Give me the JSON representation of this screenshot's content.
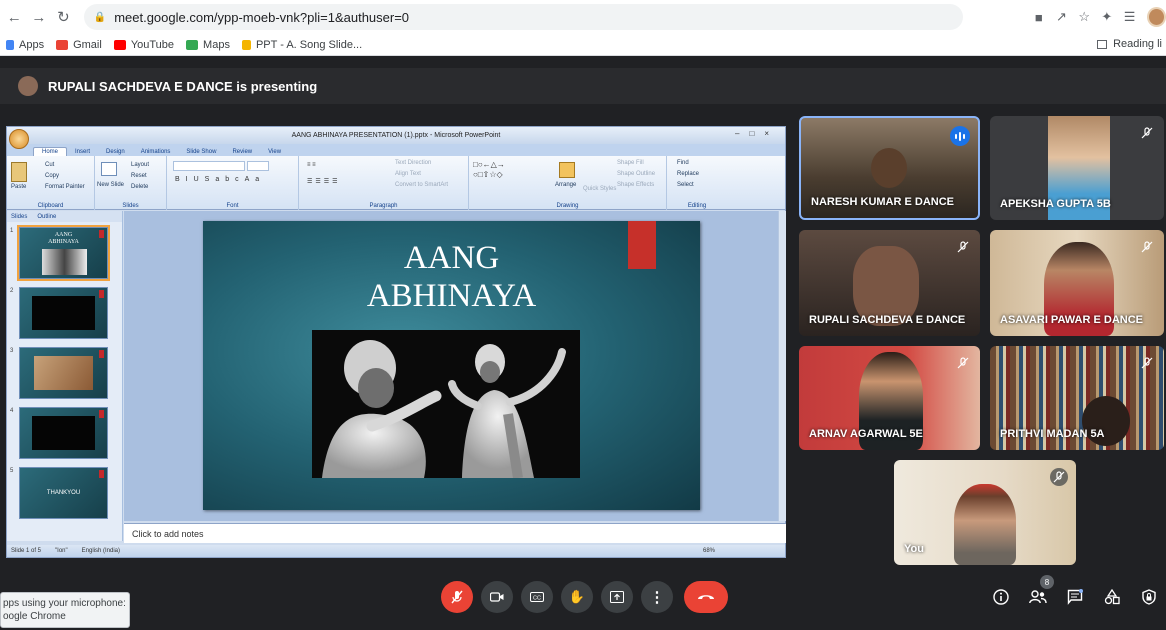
{
  "browser": {
    "url": "meet.google.com/ypp-moeb-vnk?pli=1&authuser=0",
    "bookmarks": [
      {
        "label": "Apps",
        "icon": "apps-grid-icon",
        "color": "#4285f4"
      },
      {
        "label": "Gmail",
        "icon": "gmail-icon",
        "color": "#ea4335"
      },
      {
        "label": "YouTube",
        "icon": "youtube-icon",
        "color": "#ff0000"
      },
      {
        "label": "Maps",
        "icon": "maps-icon",
        "color": "#34a853"
      },
      {
        "label": "PPT - A. Song Slide...",
        "icon": "slides-icon",
        "color": "#f4b400"
      }
    ],
    "reading_list": "Reading li"
  },
  "meet": {
    "presenting_text": "RUPALI SACHDEVA E DANCE is presenting",
    "participant_count": "8",
    "participants": [
      {
        "name": "NARESH KUMAR E DANCE",
        "mic": "speaking"
      },
      {
        "name": "APEKSHA GUPTA 5B",
        "mic": "muted"
      },
      {
        "name": "RUPALI SACHDEVA E DANCE",
        "mic": "muted"
      },
      {
        "name": "ASAVARI PAWAR E DANCE",
        "mic": "muted"
      },
      {
        "name": "ARNAV AGARWAL 5E",
        "mic": "muted"
      },
      {
        "name": "PRITHVI MADAN 5A",
        "mic": "muted"
      },
      {
        "name": "You",
        "mic": "muted"
      }
    ],
    "mic_toast": {
      "line1": "pps using your microphone:",
      "line2": "oogle Chrome"
    }
  },
  "ppt": {
    "window_title": "AANG ABHINAYA PRESENTATION (1).pptx - Microsoft PowerPoint",
    "tabs": [
      "Home",
      "Insert",
      "Design",
      "Animations",
      "Slide Show",
      "Review",
      "View"
    ],
    "active_tab": "Home",
    "ribbon": {
      "clipboard": {
        "label": "Clipboard",
        "paste": "Paste",
        "cut": "Cut",
        "copy": "Copy",
        "format_painter": "Format Painter"
      },
      "slides": {
        "label": "Slides",
        "new_slide": "New Slide",
        "layout": "Layout",
        "reset": "Reset",
        "delete": "Delete"
      },
      "font": {
        "label": "Font"
      },
      "paragraph": {
        "label": "Paragraph",
        "text_direction": "Text Direction",
        "align_text": "Align Text",
        "smartart": "Convert to SmartArt"
      },
      "drawing": {
        "label": "Drawing",
        "arrange": "Arrange",
        "quick_styles": "Quick Styles",
        "shape_fill": "Shape Fill",
        "shape_outline": "Shape Outline",
        "shape_effects": "Shape Effects"
      },
      "editing": {
        "label": "Editing",
        "find": "Find",
        "replace": "Replace",
        "select": "Select"
      }
    },
    "panel_tabs": [
      "Slides",
      "Outline"
    ],
    "thumbs": [
      {
        "num": "1",
        "text_1": "AANG",
        "text_2": "ABHINAYA",
        "kind": "title"
      },
      {
        "num": "2",
        "text_1": "",
        "text_2": "",
        "kind": "black"
      },
      {
        "num": "3",
        "text_1": "",
        "text_2": "",
        "kind": "photo"
      },
      {
        "num": "4",
        "text_1": "",
        "text_2": "",
        "kind": "black"
      },
      {
        "num": "5",
        "text_1": "THANKYOU",
        "text_2": "",
        "kind": "text"
      }
    ],
    "slide_title_1": "AANG",
    "slide_title_2": "ABHINAYA",
    "notes_placeholder": "Click to add notes",
    "status": {
      "slide": "Slide 1 of 5",
      "theme": "\"Ion\"",
      "language": "English (India)",
      "zoom": "68%"
    }
  },
  "colors": {
    "accent_blue": "#8ab4f8",
    "end_call_red": "#ea4335",
    "meet_bg": "#202124"
  }
}
